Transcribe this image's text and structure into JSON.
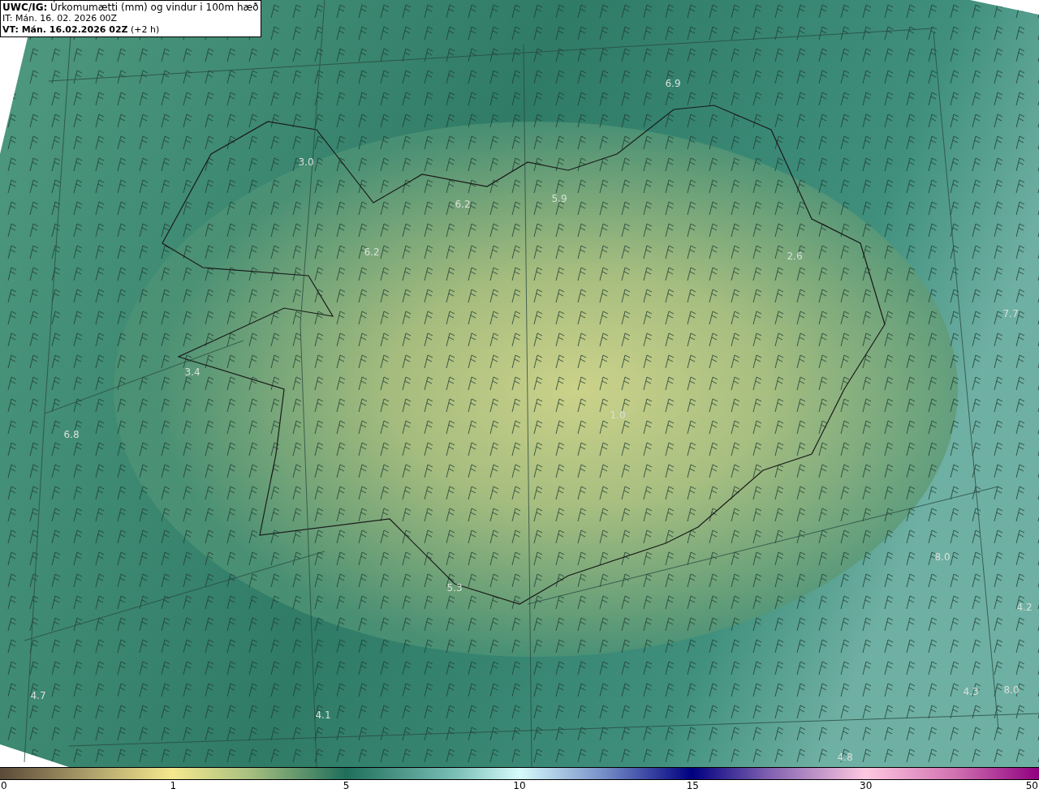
{
  "header": {
    "title": "**UWC/IG:** Úrkomumætti (mm) og vindur i 100m hæð",
    "issue_time": "IT: Mán. 16. 02. 2026 00Z",
    "valid_time": "**VT: Mán. 16.02.2026 02Z** (+2 h)"
  },
  "map_values": [
    "6.9",
    "3.0",
    "6.2",
    "5.9",
    "6.2",
    "2.6",
    "7.7",
    "3.4",
    "1.0",
    "6.8",
    "8.0",
    "5.3",
    "4.2",
    "4.7",
    "4.1",
    "4.3",
    "8.0",
    "4.8"
  ],
  "color_scale": {
    "ticks": [
      "0",
      "1",
      "5",
      "10",
      "15",
      "30",
      "50"
    ]
  }
}
